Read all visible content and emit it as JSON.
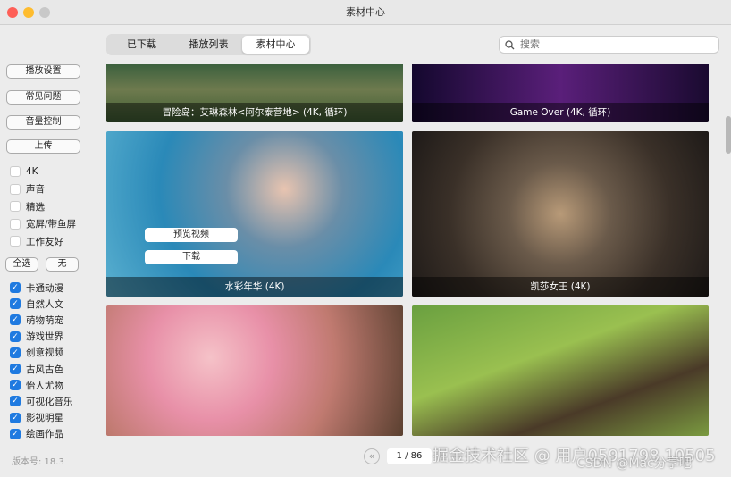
{
  "window": {
    "title": "素材中心"
  },
  "tabs": [
    {
      "label": "已下载"
    },
    {
      "label": "播放列表"
    },
    {
      "label": "素材中心"
    }
  ],
  "search": {
    "placeholder": "搜索"
  },
  "sidebar": {
    "buttons": [
      "播放设置",
      "常见问题",
      "音量控制",
      "上传"
    ],
    "filters": [
      {
        "label": "4K",
        "checked": false
      },
      {
        "label": "声音",
        "checked": false
      },
      {
        "label": "精选",
        "checked": false
      },
      {
        "label": "宽屏/带鱼屏",
        "checked": false
      },
      {
        "label": "工作友好",
        "checked": false
      }
    ],
    "select_all": "全选",
    "select_none": "无",
    "categories": [
      {
        "label": "卡通动漫",
        "checked": true
      },
      {
        "label": "自然人文",
        "checked": true
      },
      {
        "label": "萌物萌宠",
        "checked": true
      },
      {
        "label": "游戏世界",
        "checked": true
      },
      {
        "label": "创意视频",
        "checked": true
      },
      {
        "label": "古风古色",
        "checked": true
      },
      {
        "label": "怡人尤物",
        "checked": true
      },
      {
        "label": "可视化音乐",
        "checked": true
      },
      {
        "label": "影视明星",
        "checked": true
      },
      {
        "label": "绘画作品",
        "checked": true
      }
    ],
    "version": "版本号: 18.3"
  },
  "cards": [
    {
      "title": "冒险岛：艾琳森林<阿尔泰营地> (4K, 循环)"
    },
    {
      "title": "Game Over (4K, 循环)"
    },
    {
      "title": "水彩年华 (4K)",
      "preview": "预览视频",
      "download": "下载"
    },
    {
      "title": "凯莎女王 (4K)"
    },
    {
      "title": ""
    },
    {
      "title": ""
    }
  ],
  "pager": {
    "page": "1 / 86"
  },
  "watermarks": [
    "掘金技术社区 @ 用户0591798 10505",
    "CSDN @Mac分享吧"
  ]
}
